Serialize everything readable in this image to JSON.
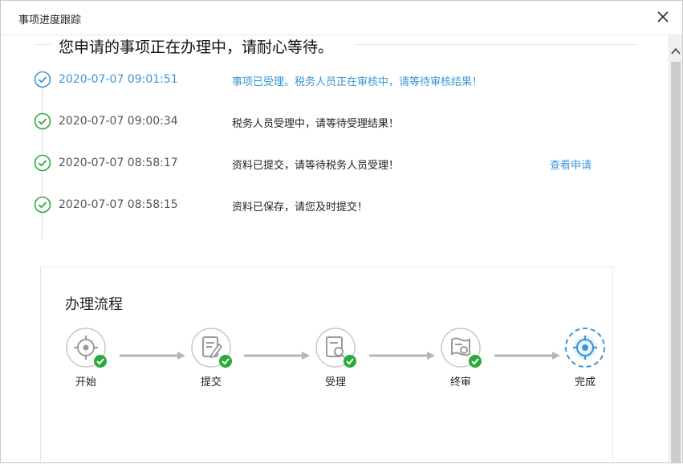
{
  "dialog": {
    "title": "事项进度跟踪",
    "close_icon": "close-icon"
  },
  "headline": "您申请的事项正在办理中，请耐心等待。",
  "timeline": [
    {
      "time": "2020-07-07 09:01:51",
      "message": "事项已受理。税务人员正在审核中，请等待审核结果！",
      "status": "active",
      "icon": "check-circle-icon"
    },
    {
      "time": "2020-07-07 09:00:34",
      "message": "税务人员受理中，请等待受理结果！",
      "status": "done",
      "icon": "check-circle-icon"
    },
    {
      "time": "2020-07-07 08:58:17",
      "message": "资料已提交，请等待税务人员受理！",
      "status": "done",
      "icon": "check-circle-icon",
      "link": "查看申请"
    },
    {
      "time": "2020-07-07 08:58:15",
      "message": "资料已保存，请您及时提交！",
      "status": "done",
      "icon": "check-circle-icon"
    }
  ],
  "flow": {
    "title": "办理流程",
    "steps": [
      {
        "label": "开始",
        "icon": "target-icon",
        "done": true
      },
      {
        "label": "提交",
        "icon": "edit-document-icon",
        "done": true
      },
      {
        "label": "受理",
        "icon": "search-document-icon",
        "done": true
      },
      {
        "label": "终审",
        "icon": "certificate-icon",
        "done": true
      },
      {
        "label": "完成",
        "icon": "target-icon",
        "done": false,
        "current": true
      }
    ]
  },
  "colors": {
    "accent": "#3a96d8",
    "success": "#2aaa3a",
    "muted": "#b5b5b5"
  }
}
